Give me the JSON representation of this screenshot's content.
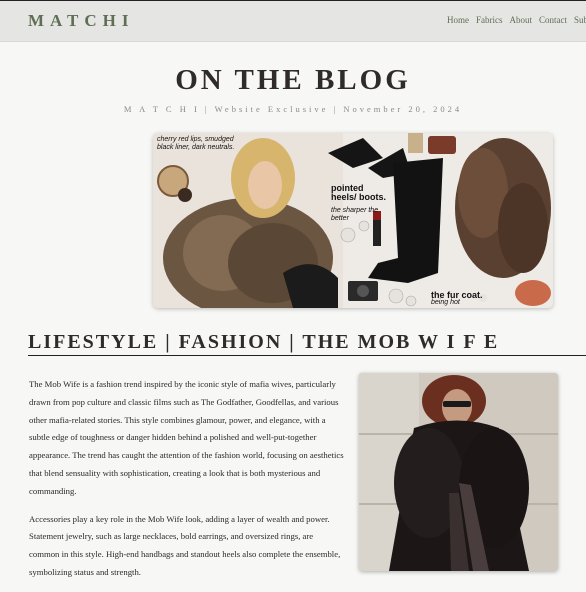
{
  "brand": {
    "name": "MATCHI"
  },
  "nav": {
    "items": [
      "Home",
      "Fabrics",
      "About",
      "Contact",
      "Subscribe"
    ]
  },
  "blog": {
    "title": "ON THE BLOG",
    "meta": "M A T C H I | Website Exclusive | November 20, 2024"
  },
  "hero": {
    "captions": {
      "lips": "cherry red lips, smudged black liner, dark neutrals.",
      "heels_title": "pointed heels/ boots.",
      "heels_sub": "the sharper the better",
      "coat_title": "the fur coat.",
      "coat_sub": "being hot"
    }
  },
  "section": {
    "title": "LIFESTYLE | FASHION | THE MOB W I F E"
  },
  "article": {
    "paragraphs": [
      "The Mob Wife is a fashion trend inspired by the iconic style of mafia wives, particularly drawn from pop culture and classic films such as The Godfather, Goodfellas, and various other mafia-related stories. This style combines glamour, power, and elegance, with a subtle edge of toughness or danger hidden behind a polished and well-put-together appearance. The trend has caught the attention of the fashion world, focusing on aesthetics that blend sensuality with sophistication, creating a look that is both mysterious and commanding.",
      "Accessories play a key role in the Mob Wife look, adding a layer of wealth and power. Statement jewelry, such as large necklaces, bold earrings, and oversized rings, are common in this style. High-end handbags and standout heels also complete the ensemble, symbolizing status and strength."
    ]
  },
  "colors": {
    "brand": "#5e6f54",
    "heading": "#2f2b2b",
    "meta": "#8a8a8a",
    "header_bg": "#e5e5e3"
  }
}
